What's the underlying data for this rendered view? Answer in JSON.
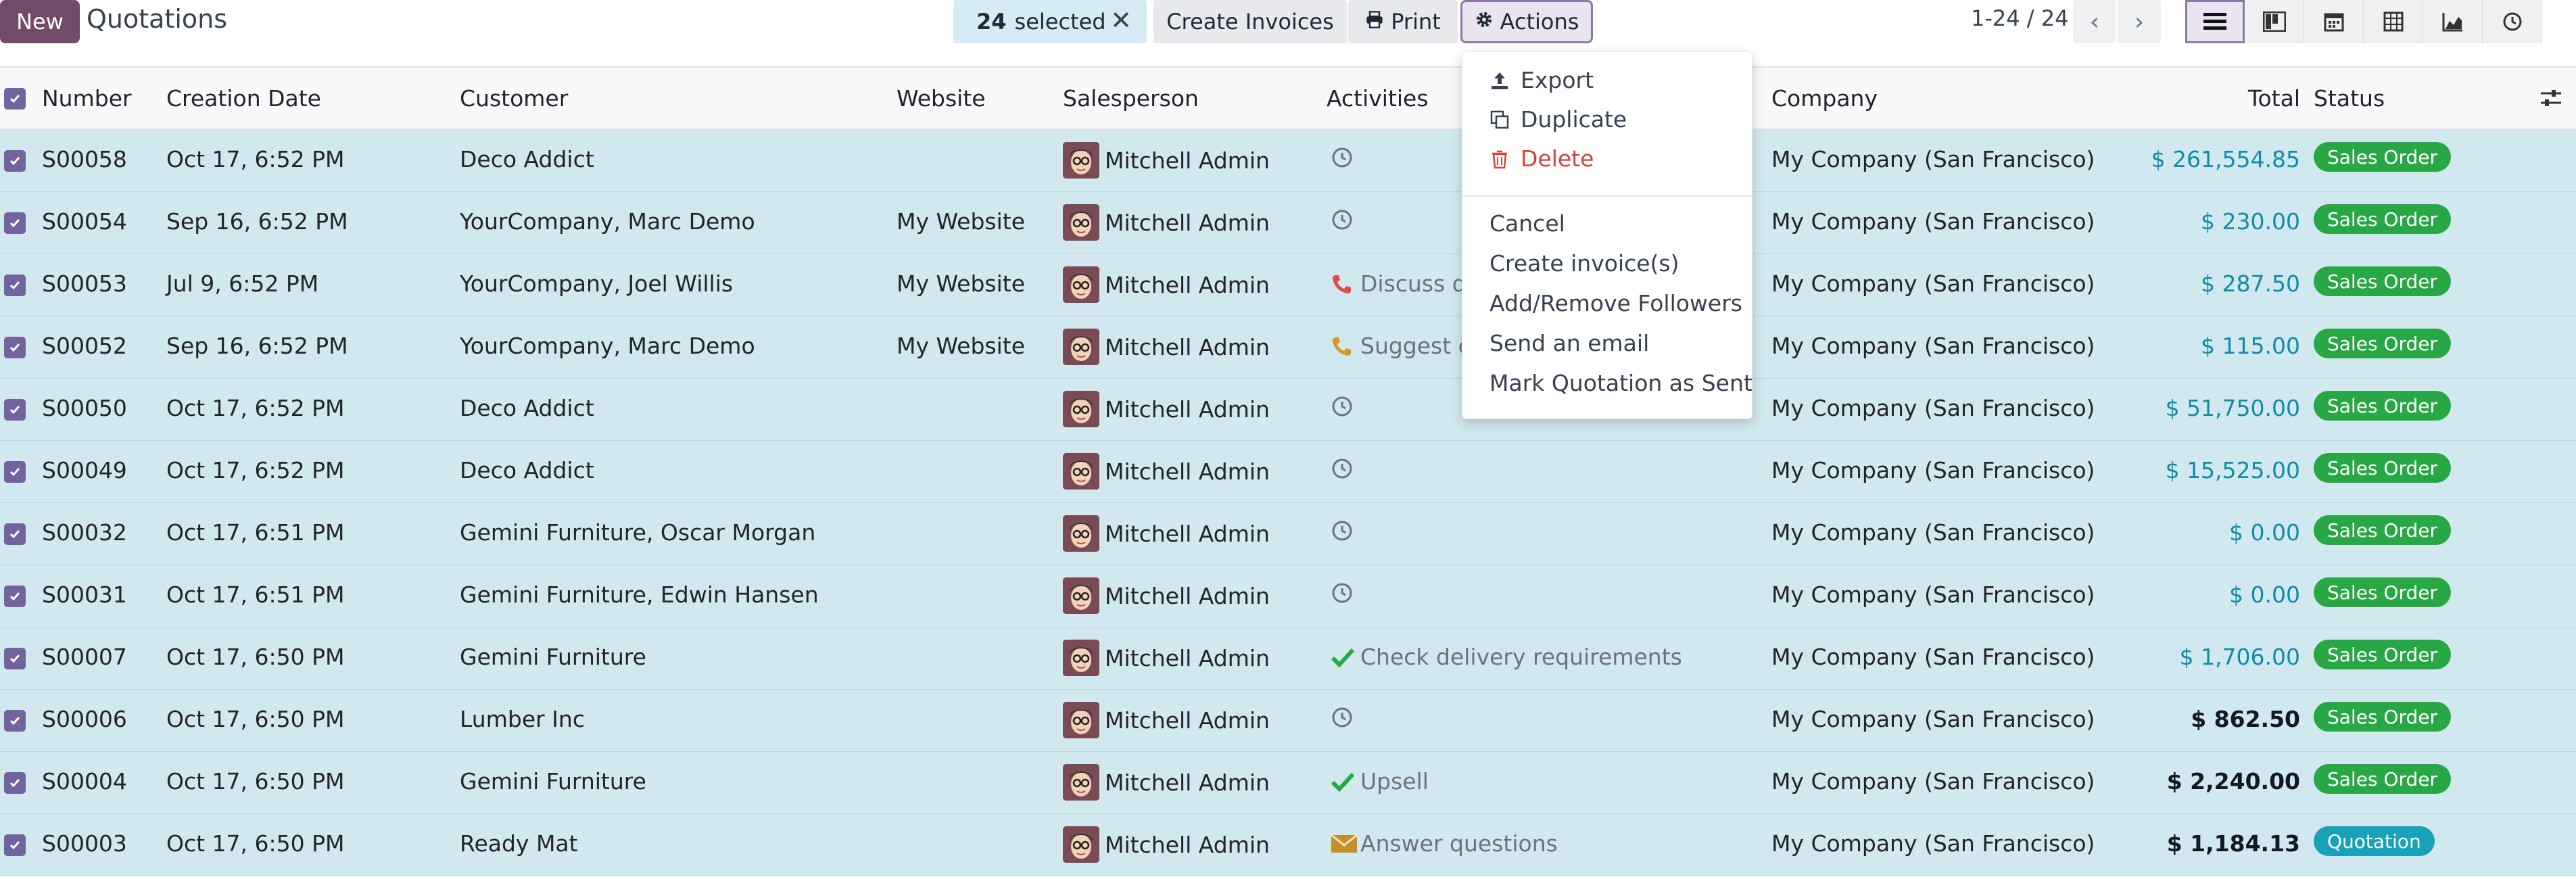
{
  "app": {
    "new_label": "New",
    "title": "Quotations"
  },
  "selection": {
    "count": "24",
    "label": "selected"
  },
  "toolbar": {
    "create_invoices_label": "Create Invoices",
    "print_label": "Print",
    "actions_label": "Actions"
  },
  "pager": {
    "range": "1-24 / 24"
  },
  "views": [
    "list-view-icon",
    "kanban-view-icon",
    "calendar-view-icon",
    "pivot-view-icon",
    "graph-view-icon",
    "activity-view-icon"
  ],
  "table": {
    "columns": {
      "number": "Number",
      "creation_date": "Creation Date",
      "customer": "Customer",
      "website": "Website",
      "salesperson": "Salesperson",
      "activities": "Activities",
      "company": "Company",
      "total": "Total",
      "status": "Status"
    },
    "rows": [
      {
        "number": "S00058",
        "date": "Oct 17, 6:52 PM",
        "customer": "Deco Addict",
        "website": "",
        "salesperson": "Mitchell Admin",
        "activity_icon": "clock",
        "activity": "",
        "company": "My Company (San Francisco)",
        "total": "$ 261,554.85",
        "total_style": "blue",
        "status": "Sales Order"
      },
      {
        "number": "S00054",
        "date": "Sep 16, 6:52 PM",
        "customer": "YourCompany, Marc Demo",
        "website": "My Website",
        "salesperson": "Mitchell Admin",
        "activity_icon": "clock",
        "activity": "",
        "company": "My Company (San Francisco)",
        "total": "$ 230.00",
        "total_style": "blue",
        "status": "Sales Order"
      },
      {
        "number": "S00053",
        "date": "Jul 9, 6:52 PM",
        "customer": "YourCompany, Joel Willis",
        "website": "My Website",
        "salesperson": "Mitchell Admin",
        "activity_icon": "phone-red",
        "activity": "Discuss d",
        "company": "My Company (San Francisco)",
        "total": "$ 287.50",
        "total_style": "blue",
        "status": "Sales Order"
      },
      {
        "number": "S00052",
        "date": "Sep 16, 6:52 PM",
        "customer": "YourCompany, Marc Demo",
        "website": "My Website",
        "salesperson": "Mitchell Admin",
        "activity_icon": "phone-orange",
        "activity": "Suggest c",
        "company": "My Company (San Francisco)",
        "total": "$ 115.00",
        "total_style": "blue",
        "status": "Sales Order"
      },
      {
        "number": "S00050",
        "date": "Oct 17, 6:52 PM",
        "customer": "Deco Addict",
        "website": "",
        "salesperson": "Mitchell Admin",
        "activity_icon": "clock",
        "activity": "",
        "company": "My Company (San Francisco)",
        "total": "$ 51,750.00",
        "total_style": "blue",
        "status": "Sales Order"
      },
      {
        "number": "S00049",
        "date": "Oct 17, 6:52 PM",
        "customer": "Deco Addict",
        "website": "",
        "salesperson": "Mitchell Admin",
        "activity_icon": "clock",
        "activity": "",
        "company": "My Company (San Francisco)",
        "total": "$ 15,525.00",
        "total_style": "blue",
        "status": "Sales Order"
      },
      {
        "number": "S00032",
        "date": "Oct 17, 6:51 PM",
        "customer": "Gemini Furniture, Oscar Morgan",
        "website": "",
        "salesperson": "Mitchell Admin",
        "activity_icon": "clock",
        "activity": "",
        "company": "My Company (San Francisco)",
        "total": "$ 0.00",
        "total_style": "blue",
        "status": "Sales Order"
      },
      {
        "number": "S00031",
        "date": "Oct 17, 6:51 PM",
        "customer": "Gemini Furniture, Edwin Hansen",
        "website": "",
        "salesperson": "Mitchell Admin",
        "activity_icon": "clock",
        "activity": "",
        "company": "My Company (San Francisco)",
        "total": "$ 0.00",
        "total_style": "blue",
        "status": "Sales Order"
      },
      {
        "number": "S00007",
        "date": "Oct 17, 6:50 PM",
        "customer": "Gemini Furniture",
        "website": "",
        "salesperson": "Mitchell Admin",
        "activity_icon": "check",
        "activity": "Check delivery requirements",
        "company": "My Company (San Francisco)",
        "total": "$ 1,706.00",
        "total_style": "blue",
        "status": "Sales Order"
      },
      {
        "number": "S00006",
        "date": "Oct 17, 6:50 PM",
        "customer": "Lumber Inc",
        "website": "",
        "salesperson": "Mitchell Admin",
        "activity_icon": "clock",
        "activity": "",
        "company": "My Company (San Francisco)",
        "total": "$ 862.50",
        "total_style": "bold",
        "status": "Sales Order"
      },
      {
        "number": "S00004",
        "date": "Oct 17, 6:50 PM",
        "customer": "Gemini Furniture",
        "website": "",
        "salesperson": "Mitchell Admin",
        "activity_icon": "check",
        "activity": "Upsell",
        "company": "My Company (San Francisco)",
        "total": "$ 2,240.00",
        "total_style": "bold",
        "status": "Sales Order"
      },
      {
        "number": "S00003",
        "date": "Oct 17, 6:50 PM",
        "customer": "Ready Mat",
        "website": "",
        "salesperson": "Mitchell Admin",
        "activity_icon": "envelope",
        "activity": "Answer questions",
        "company": "My Company (San Francisco)",
        "total": "$ 1,184.13",
        "total_style": "bold",
        "status": "Quotation"
      }
    ]
  },
  "status_colors": {
    "Sales Order": "#28a745",
    "Quotation": "#17a2b8"
  },
  "actions_menu": {
    "export": "Export",
    "duplicate": "Duplicate",
    "delete": "Delete",
    "items": [
      "Cancel",
      "Create invoice(s)",
      "Add/Remove Followers",
      "Send an email",
      "Mark Quotation as Sent"
    ]
  },
  "colors": {
    "brand": "#714b67",
    "selected_row": "#d1e9ee",
    "checkbox": "#71639e",
    "danger": "#d9413a"
  }
}
